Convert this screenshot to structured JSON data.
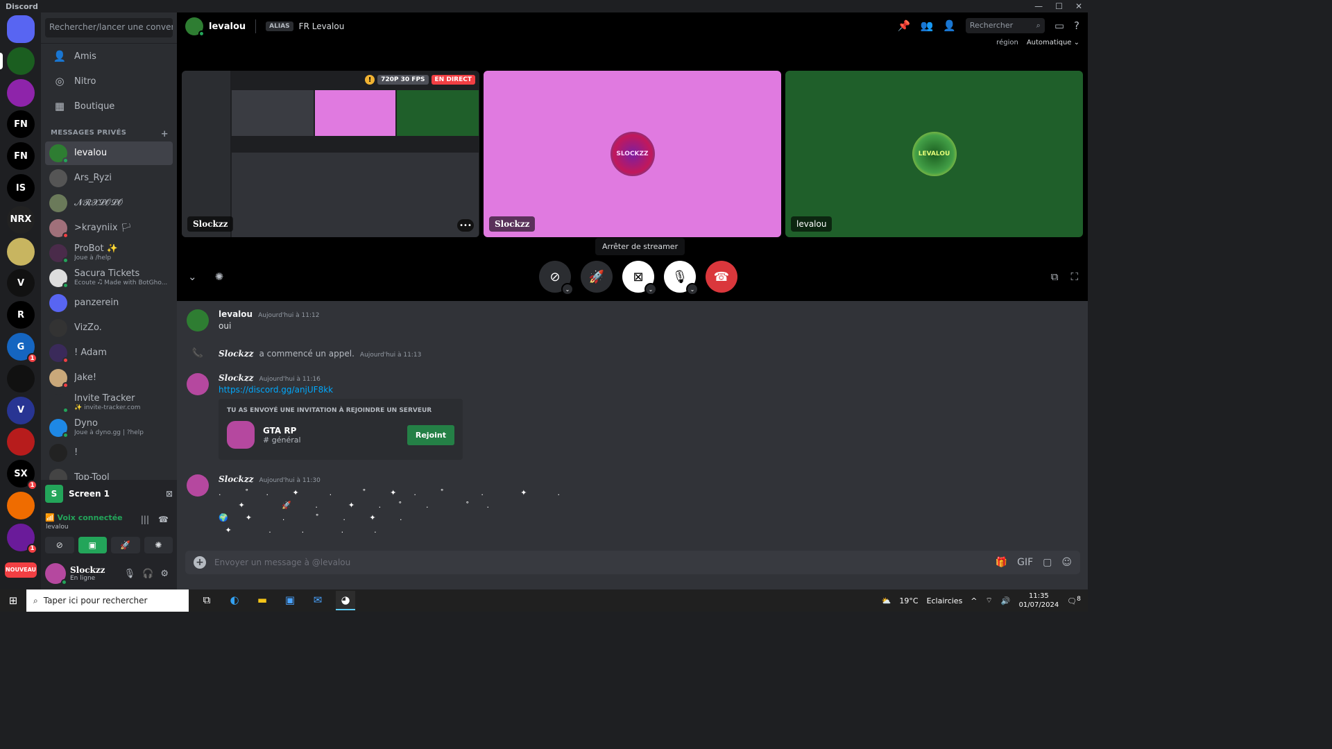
{
  "app": {
    "title": "Discord",
    "window_controls": [
      "—",
      "☐",
      "✕"
    ]
  },
  "sidebar": {
    "search_placeholder": "Rechercher/lancer une conversa...",
    "nav": [
      {
        "label": "Amis",
        "icon": "friends-icon"
      },
      {
        "label": "Nitro",
        "icon": "nitro-icon"
      },
      {
        "label": "Boutique",
        "icon": "shop-icon"
      }
    ],
    "dm_header": "MESSAGES PRIVÉS",
    "dm_add": "+",
    "dms": [
      {
        "name": "levalou",
        "sub": "",
        "color": "#2e7d32",
        "status": "#23a55a",
        "selected": true
      },
      {
        "name": "Ars_Ryzi",
        "sub": "",
        "color": "#555",
        "status": ""
      },
      {
        "name": "𝓝𝓡𝓧𝓛𝓞𝓛𝓞",
        "sub": "",
        "color": "#6b7a5a",
        "status": ""
      },
      {
        "name": ">krayniix 🏳",
        "sub": "",
        "color": "#a0707a",
        "status": "#f23f43"
      },
      {
        "name": "ProBot ✨",
        "sub": "Joue à /help",
        "color": "#4a2b4a",
        "status": "#23a55a"
      },
      {
        "name": "Sacura Tickets",
        "sub": "Écoute 🎝 Made with BotGho...",
        "color": "#ddd",
        "status": "#23a55a"
      },
      {
        "name": "panzerein",
        "sub": "",
        "color": "#5865f2",
        "status": ""
      },
      {
        "name": "VizZo.",
        "sub": "",
        "color": "#333",
        "status": ""
      },
      {
        "name": "! Adam",
        "sub": "",
        "color": "#3a2a5a",
        "status": "#f23f43"
      },
      {
        "name": "Jake!",
        "sub": "",
        "color": "#c9a87a",
        "status": "#f23f43"
      },
      {
        "name": "Invite Tracker",
        "sub": "✨ invite-tracker.com",
        "color": "#2b2d31",
        "status": "#23a55a"
      },
      {
        "name": "Dyno",
        "sub": "Joue à dyno.gg | ?help",
        "color": "#1e88e5",
        "status": "#23a55a"
      },
      {
        "name": "!",
        "sub": "",
        "color": "#222",
        "status": ""
      },
      {
        "name": "Top-Tool",
        "sub": "",
        "color": "#444",
        "status": ""
      }
    ],
    "voice": {
      "screen_label": "Screen 1",
      "screen_icon_letter": "S",
      "connected": "Voix connectée",
      "channel": "levalou"
    },
    "user": {
      "name": "Slockzz",
      "status": "En ligne"
    }
  },
  "guilds": [
    {
      "label": "",
      "color": "#5865f2",
      "badge": ""
    },
    {
      "label": "",
      "color": "#1b5e20",
      "badge": ""
    },
    {
      "label": "",
      "color": "#8e24aa",
      "badge": ""
    },
    {
      "label": "FN",
      "color": "#000000",
      "badge": ""
    },
    {
      "label": "FN",
      "color": "#000000",
      "badge": ""
    },
    {
      "label": "IS",
      "color": "#000000",
      "badge": ""
    },
    {
      "label": "NRX",
      "color": "#222",
      "badge": ""
    },
    {
      "label": "",
      "color": "#c8b560",
      "badge": ""
    },
    {
      "label": "V",
      "color": "#111",
      "badge": ""
    },
    {
      "label": "R",
      "color": "#000000",
      "badge": ""
    },
    {
      "label": "G",
      "color": "#1565c0",
      "badge": "1"
    },
    {
      "label": "",
      "color": "#111",
      "badge": ""
    },
    {
      "label": "V",
      "color": "#283593",
      "badge": ""
    },
    {
      "label": "",
      "color": "#b71c1c",
      "badge": ""
    },
    {
      "label": "SX",
      "color": "#000000",
      "badge": "1"
    },
    {
      "label": "",
      "color": "#ef6c00",
      "badge": ""
    },
    {
      "label": "",
      "color": "#6a1b9a",
      "badge": "1"
    },
    {
      "label": "NOUVEAU",
      "color": "#f23f43",
      "badge": ""
    }
  ],
  "header": {
    "name": "levalou",
    "alias_tag": "ALIAS",
    "alias_name": "FR Levalou",
    "search_placeholder": "Rechercher",
    "region_label": "région",
    "region_value": "Automatique ⌄"
  },
  "call": {
    "tiles": [
      {
        "label": "Slockzz",
        "kind": "screen",
        "badge_quality": "720P 30 FPS",
        "badge_live": "EN DIRECT"
      },
      {
        "label": "Slockzz",
        "kind": "avatar",
        "bg": "#e07ae0",
        "orb_text": "SLOCKZZ"
      },
      {
        "label": "levalou",
        "kind": "avatar",
        "bg": "#1f5f2a",
        "orb_text": "LEVALOU"
      }
    ],
    "tooltip": "Arrêter de streamer"
  },
  "messages": [
    {
      "author": "levalou",
      "time": "Aujourd'hui à 11:12",
      "text": "oui"
    },
    {
      "author": "Slockzz",
      "system_text": "a commencé un appel.",
      "time": "Aujourd'hui à 11:13"
    },
    {
      "author": "Slockzz",
      "time": "Aujourd'hui à 11:16",
      "link": "https://discord.gg/anjUF8kk",
      "invite": {
        "title": "TU AS ENVOYÉ UNE INVITATION À REJOINDRE UN SERVEUR",
        "server": "GTA RP",
        "channel": "général",
        "button": "Rejoint"
      }
    },
    {
      "author": "Slockzz",
      "time": "Aujourd'hui à 11:30",
      "stars": ".   ˚  .   ✦    .    ˚   ✦  .   ˚     .     ✦    .\n   ✦     🚀   .    ✦   .  ˚   .     ˚  .\n🌍  ✦    .    ˚   .   ✦   .\n ✦     .    .     .    ."
    }
  ],
  "composer": {
    "placeholder": "Envoyer un message à @levalou"
  },
  "taskbar": {
    "search": "Taper ici pour rechercher",
    "weather_temp": "19°C",
    "weather_text": "Eclaircies",
    "time": "11:35",
    "date": "01/07/2024",
    "notif": "8"
  }
}
